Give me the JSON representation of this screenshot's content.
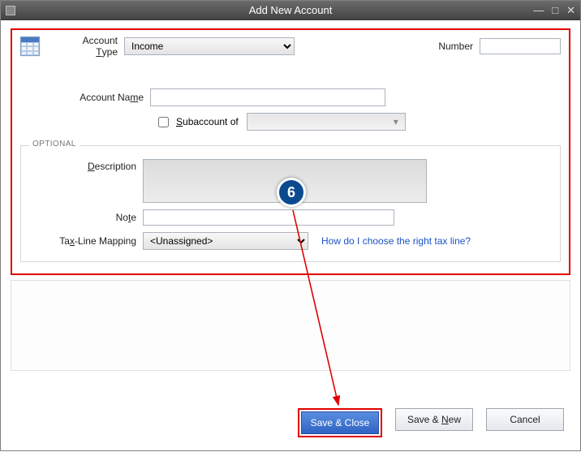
{
  "window": {
    "title": "Add New Account"
  },
  "fields": {
    "account_type_label_pre": "Account ",
    "account_type_label_u": "T",
    "account_type_label_post": "ype",
    "account_type_value": "Income",
    "number_label": "Number",
    "number_value": "",
    "account_name_label_pre": "Account Na",
    "account_name_label_u": "m",
    "account_name_label_post": "e",
    "account_name_value": "",
    "subaccount_pre": "",
    "subaccount_u": "S",
    "subaccount_post": "ubaccount of",
    "subaccount_checked": false,
    "subaccount_value": ""
  },
  "optional": {
    "group_label": "OPTIONAL",
    "description_label_u": "D",
    "description_label_post": "escription",
    "description_value": "",
    "note_label_pre": "No",
    "note_label_u": "t",
    "note_label_post": "e",
    "note_value": "",
    "taxline_label_pre": "Ta",
    "taxline_label_u": "x",
    "taxline_label_post": "-Line Mapping",
    "taxline_value": "<Unassigned>",
    "taxline_help": "How do I choose the right tax line?"
  },
  "buttons": {
    "save_close": "Save & Close",
    "save_new_pre": "Save & ",
    "save_new_u": "N",
    "save_new_post": "ew",
    "cancel": "Cancel"
  },
  "annotation": {
    "badge": "6"
  }
}
